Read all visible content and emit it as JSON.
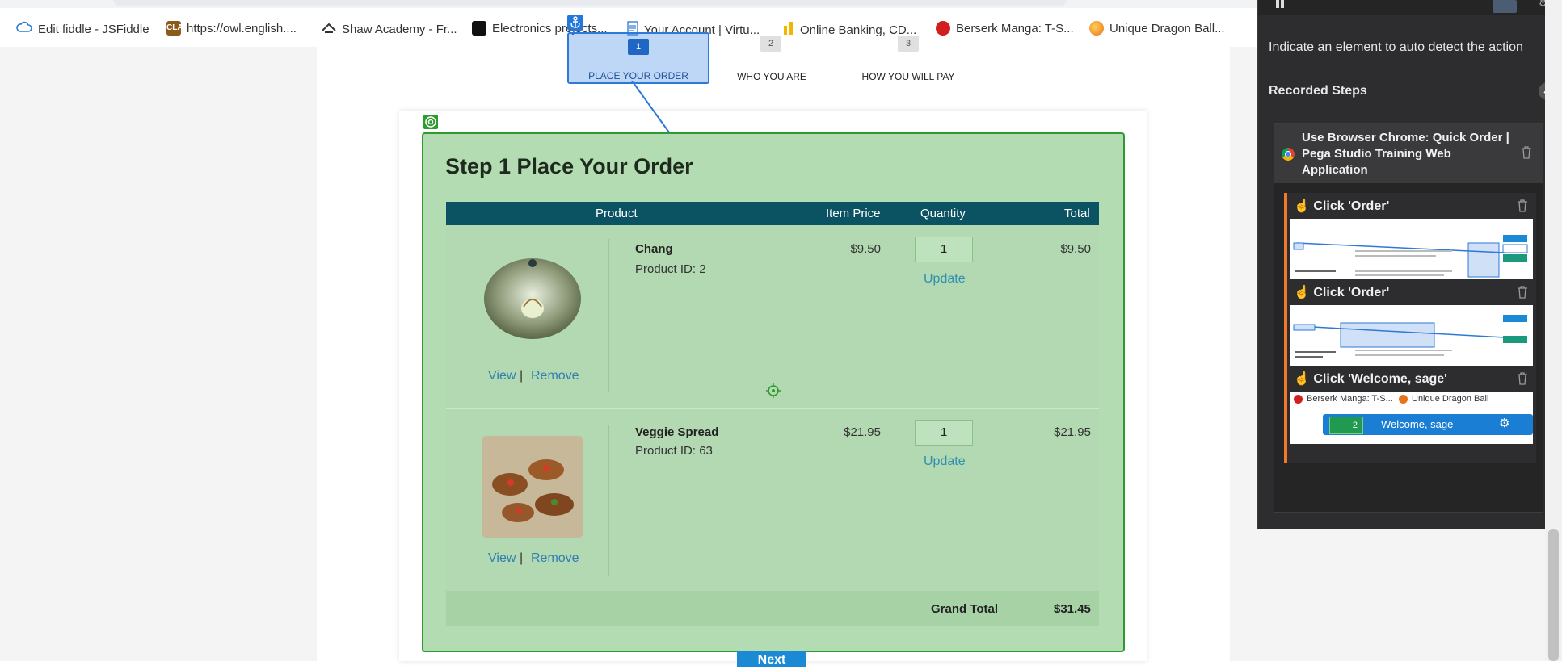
{
  "bookmarks": [
    {
      "label": "Edit fiddle - JSFiddle",
      "icon": "cloud-icon"
    },
    {
      "label": "https://owl.english....",
      "icon": "owl-icon"
    },
    {
      "label": "Shaw Academy - Fr...",
      "icon": "shaw-icon"
    },
    {
      "label": "Electronics projects...",
      "icon": "electronics-icon"
    },
    {
      "label": "Your Account | Virtu...",
      "icon": "document-icon"
    },
    {
      "label": "Online Banking, CD...",
      "icon": "bank-icon"
    },
    {
      "label": "Berserk Manga: T-S...",
      "icon": "berserk-icon"
    },
    {
      "label": "Unique Dragon Ball...",
      "icon": "dragon-ball-icon"
    }
  ],
  "wizard": {
    "steps": [
      {
        "number": "1",
        "label": "PLACE YOUR ORDER",
        "active": true
      },
      {
        "number": "2",
        "label": "WHO YOU ARE",
        "active": false
      },
      {
        "number": "3",
        "label": "HOW YOU WILL PAY",
        "active": false
      }
    ]
  },
  "order": {
    "title": "Step 1 Place Your Order",
    "columns": [
      "Product",
      "Item Price",
      "Quantity",
      "Total"
    ],
    "items": [
      {
        "name": "Chang",
        "product_id": "Product ID: 2",
        "price": "$9.50",
        "quantity": "1",
        "total": "$9.50",
        "view": "View",
        "separator": "|",
        "remove": "Remove",
        "update": "Update"
      },
      {
        "name": "Veggie Spread",
        "product_id": "Product ID: 63",
        "price": "$21.95",
        "quantity": "1",
        "total": "$21.95",
        "view": "View",
        "separator": "|",
        "remove": "Remove",
        "update": "Update"
      }
    ],
    "grand_total_label": "Grand Total",
    "grand_total": "$31.45",
    "next_label": "Next"
  },
  "recorder": {
    "hint": "Indicate an element to auto detect the action",
    "recorded_steps_title": "Recorded Steps",
    "group_title": "Use Browser Chrome: Quick Order | Pega Studio Training Web Application",
    "steps": [
      {
        "label": "Click 'Order'"
      },
      {
        "label": "Click 'Order'"
      },
      {
        "label": "Click 'Welcome, sage'",
        "thumb_bookmarks": [
          "Berserk Manga: T-S...",
          "Unique Dragon Ball"
        ],
        "thumb_cart_count": "2",
        "thumb_welcome": "Welcome, sage"
      }
    ]
  },
  "colors": {
    "table_header": "#0b5363",
    "highlight_fill": "#b3dcb2",
    "highlight_border": "#2e9b2e",
    "selection_blue": "#2d78d8",
    "panel_bg": "#2d2d30",
    "step_accent": "#f07a2a"
  }
}
